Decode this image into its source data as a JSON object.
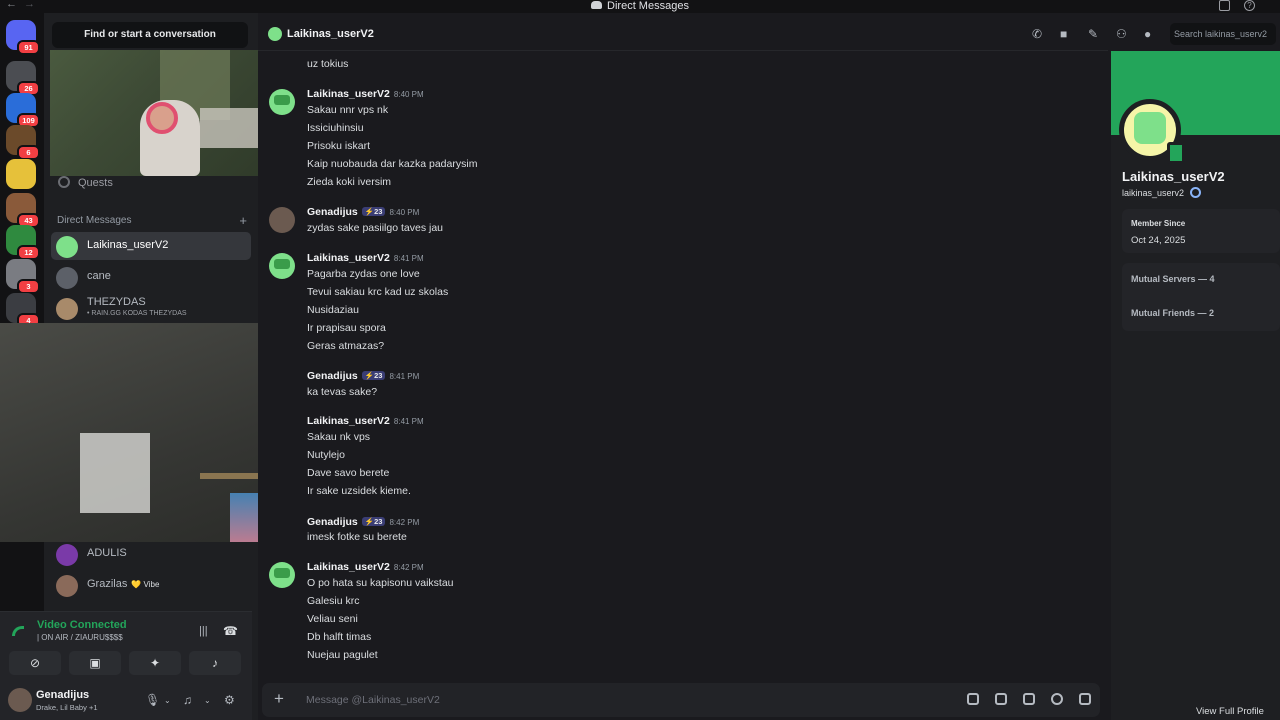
{
  "window": {
    "title": "Direct Messages"
  },
  "guild_badges": [
    "91",
    "26",
    "109",
    "6",
    "43",
    "12",
    "3",
    "4"
  ],
  "dm_sidebar": {
    "search_label": "Find or start a conversation",
    "quests_label": "Quests",
    "section_label": "Direct Messages",
    "items": [
      {
        "name": "Laikinas_userV2"
      },
      {
        "name": "cane"
      },
      {
        "name": "THEZYDAS",
        "sub": "• RAIN.GG KODAS THEZYDAS"
      },
      {
        "name": "ADULIS"
      },
      {
        "name": "Grazilas",
        "vibe": "💛 Vibe"
      }
    ]
  },
  "voice": {
    "status": "Video Connected",
    "channel": "| ON AIR / ZIAURU$$$$"
  },
  "user_panel": {
    "name": "Genadijus",
    "activity": "Drake, Lil Baby +1"
  },
  "chat": {
    "recipient": "Laikinas_userV2",
    "search_placeholder": "Search laikinas_userv2",
    "composer_placeholder": "Message @Laikinas_userV2",
    "top_line": "uz tokius",
    "messages": [
      {
        "author": "Laikinas_userV2",
        "time": "8:40 PM",
        "lines": [
          "Sakau nnr vps nk",
          "Issiciuhinsiu",
          "Prisoku iskart",
          "Kaip nuobauda dar kazka padarysim",
          "Zieda koki iversim"
        ]
      },
      {
        "author": "Genadijus",
        "tag": "⚡23",
        "time": "8:40 PM",
        "lines": [
          "zydas sake  pasiilgo taves jau"
        ]
      },
      {
        "author": "Laikinas_userV2",
        "time": "8:41 PM",
        "lines": [
          "Pagarba zydas one love",
          "Tevui sakiau krc kad uz skolas",
          "Nusidaziau",
          "Ir prapisau spora",
          "Geras atmazas?"
        ]
      },
      {
        "author": "Genadijus",
        "tag": "⚡23",
        "time": "8:41 PM",
        "lines": [
          "ka tevas sake?"
        ]
      },
      {
        "author": "Laikinas_userV2",
        "time": "8:41 PM",
        "lines": [
          "Sakau nk vps",
          "Nutylejo",
          "Dave savo berete",
          "Ir sake uzsidek kieme."
        ]
      },
      {
        "author": "Genadijus",
        "tag": "⚡23",
        "time": "8:42 PM",
        "lines": [
          "imesk fotke su berete"
        ]
      },
      {
        "author": "Laikinas_userV2",
        "time": "8:42 PM",
        "lines": [
          "O po hata su kapisonu vaikstau",
          "Galesiu krc",
          "Veliau seni",
          "Db halft timas",
          "Nuejau pagulet"
        ]
      }
    ]
  },
  "profile": {
    "display_name": "Laikinas_userV2",
    "username": "laikinas_userv2",
    "member_since_label": "Member Since",
    "member_since": "Oct 24, 2025",
    "mutual_servers": "Mutual Servers — 4",
    "mutual_friends": "Mutual Friends — 2",
    "view_full": "View Full Profile"
  },
  "colors": {
    "accent": "#5865f2",
    "online": "#23a55a",
    "badge": "#f23f43",
    "banner": "#23a55a"
  }
}
